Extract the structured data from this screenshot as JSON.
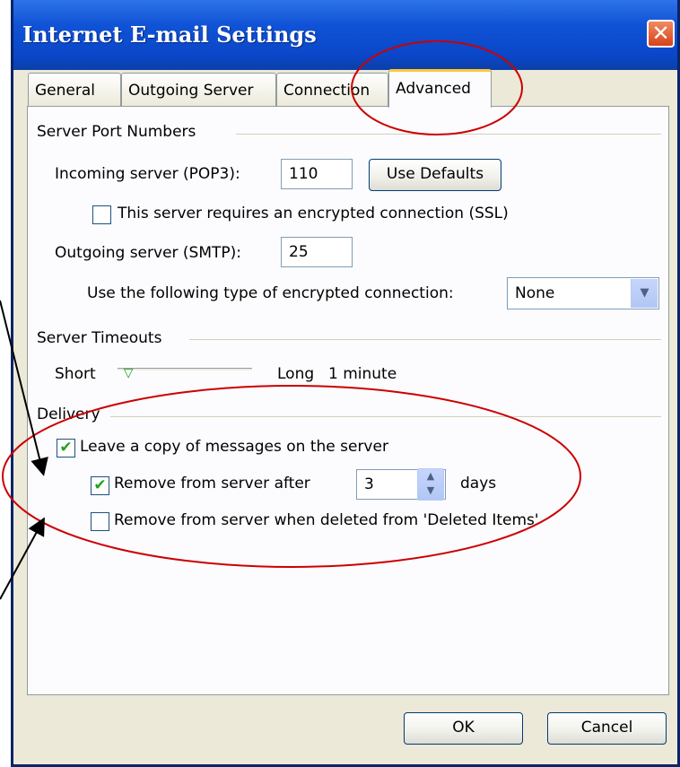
{
  "window": {
    "title": "Internet E-mail Settings",
    "close_glyph": "✕"
  },
  "tabs": [
    {
      "label": "General"
    },
    {
      "label": "Outgoing Server"
    },
    {
      "label": "Connection"
    },
    {
      "label": "Advanced",
      "active": true
    }
  ],
  "server_ports": {
    "heading": "Server Port Numbers",
    "incoming_label": "Incoming server (POP3):",
    "incoming_value": "110",
    "use_defaults_label": "Use Defaults",
    "ssl_label": "This server requires an encrypted connection (SSL)",
    "ssl_checked": false,
    "outgoing_label": "Outgoing server (SMTP):",
    "outgoing_value": "25",
    "encryption_label": "Use the following type of encrypted connection:",
    "encryption_value": "None"
  },
  "timeouts": {
    "heading": "Server Timeouts",
    "short_label": "Short",
    "long_label": "Long",
    "value_text": "1 minute",
    "level": 0.05
  },
  "delivery": {
    "heading": "Delivery",
    "leave_copy_label": "Leave a copy of messages on the server",
    "leave_copy_checked": true,
    "remove_after_label": "Remove from server after",
    "remove_after_checked": true,
    "remove_after_days": "3",
    "days_label": "days",
    "remove_deleted_label": "Remove from server when deleted from 'Deleted Items'",
    "remove_deleted_checked": false
  },
  "buttons": {
    "ok": "OK",
    "cancel": "Cancel"
  },
  "icons": {
    "close": "close-icon",
    "check": "check-icon",
    "dropdown": "chevron-down-icon",
    "spinner": "spinner-arrows-icon"
  },
  "colors": {
    "title_bar": "#0a46c8",
    "dialog_bg": "#ece9d8",
    "annotation_red": "#cc0000",
    "check_green": "#21a121",
    "active_tab_highlight": "#ffc83c"
  }
}
